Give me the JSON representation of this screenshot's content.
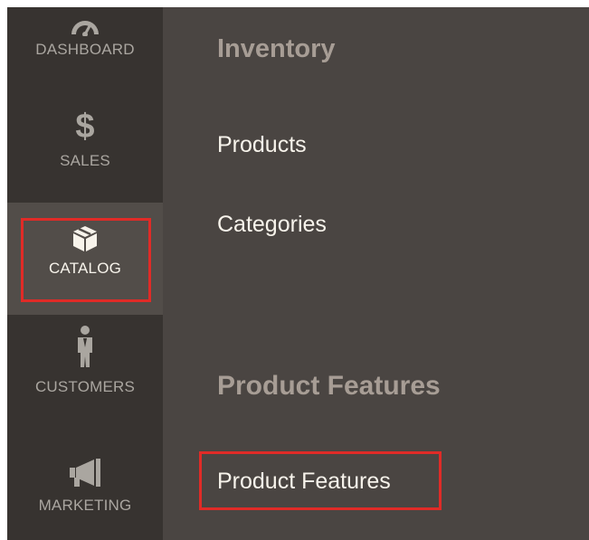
{
  "sidebar": {
    "items": [
      {
        "id": "dashboard",
        "label": "DASHBOARD",
        "icon": "gauge-icon"
      },
      {
        "id": "sales",
        "label": "SALES",
        "icon": "dollar-icon",
        "glyph": "$"
      },
      {
        "id": "catalog",
        "label": "CATALOG",
        "icon": "box-icon",
        "active": true
      },
      {
        "id": "customers",
        "label": "CUSTOMERS",
        "icon": "person-icon"
      },
      {
        "id": "marketing",
        "label": "MARKETING",
        "icon": "megaphone-icon"
      }
    ]
  },
  "panel": {
    "sections": [
      {
        "title": "Inventory",
        "links": [
          "Products",
          "Categories"
        ]
      },
      {
        "title": "Product Features",
        "links": [
          "Product Features"
        ]
      }
    ]
  },
  "colors": {
    "sidebar_bg": "#373330",
    "sidebar_active_bg": "#524d49",
    "panel_bg": "#4a4542",
    "section_title": "#a79d95",
    "link_text": "#f7f3eb",
    "highlight": "#e02b27"
  }
}
